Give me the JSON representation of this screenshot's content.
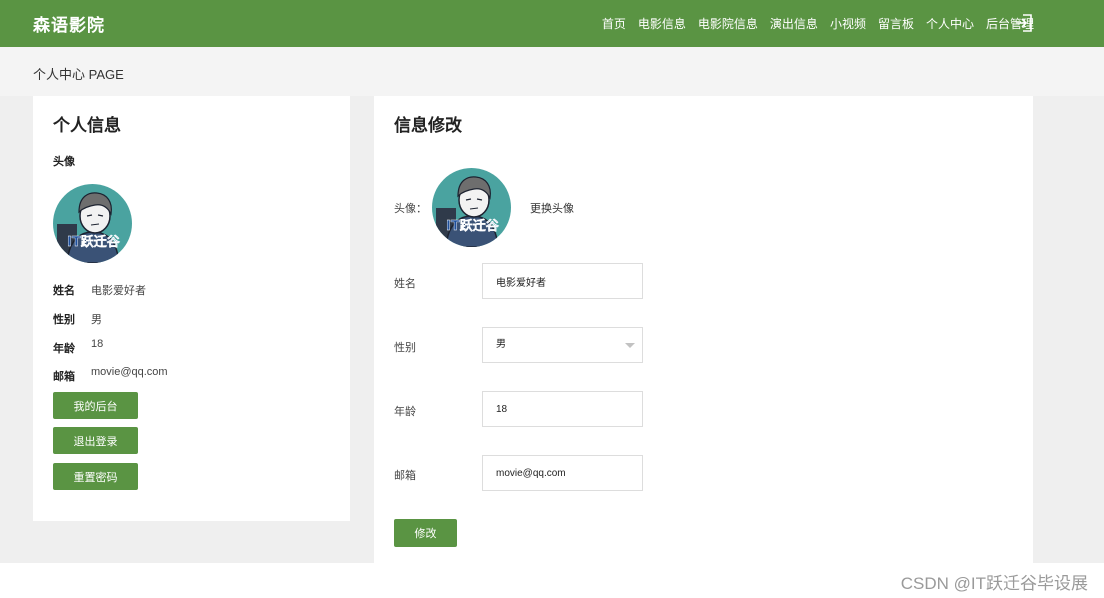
{
  "app": {
    "logo": "森语影院"
  },
  "nav": {
    "items": [
      {
        "id": "home",
        "label": "首页"
      },
      {
        "id": "movies",
        "label": "电影信息"
      },
      {
        "id": "cinemas",
        "label": "电影院信息"
      },
      {
        "id": "shows",
        "label": "演出信息"
      },
      {
        "id": "videos",
        "label": "小视频"
      },
      {
        "id": "messages",
        "label": "留言板"
      },
      {
        "id": "profile",
        "label": "个人中心"
      },
      {
        "id": "admin",
        "label": "后台管理"
      }
    ],
    "logout_icon": "logout-icon"
  },
  "breadcrumb": {
    "text": "个人中心 PAGE"
  },
  "profile": {
    "title": "个人信息",
    "avatar_label": "头像",
    "avatar_icon": "user-avatar",
    "fields": {
      "name_label": "姓名",
      "name_value": "电影爱好者",
      "gender_label": "性别",
      "gender_value": "男",
      "age_label": "年龄",
      "age_value": "18",
      "email_label": "邮箱",
      "email_value": "movie@qq.com"
    },
    "buttons": {
      "backend": "我的后台",
      "logout": "退出登录",
      "reset_password": "重置密码"
    }
  },
  "edit": {
    "title": "信息修改",
    "avatar_label": "头像：",
    "change_avatar": "更换头像",
    "name_label": "姓名",
    "name_value": "电影爱好者",
    "gender_label": "性别",
    "gender_value": "男",
    "age_label": "年龄",
    "age_value": "18",
    "email_label": "邮箱",
    "email_value": "movie@qq.com",
    "submit": "修改"
  },
  "watermark": "CSDN @IT跃迁谷毕设展",
  "colors": {
    "brand_green": "#5a9443",
    "page_bg": "#efefef",
    "avatar_teal": "#4aa3a0"
  }
}
